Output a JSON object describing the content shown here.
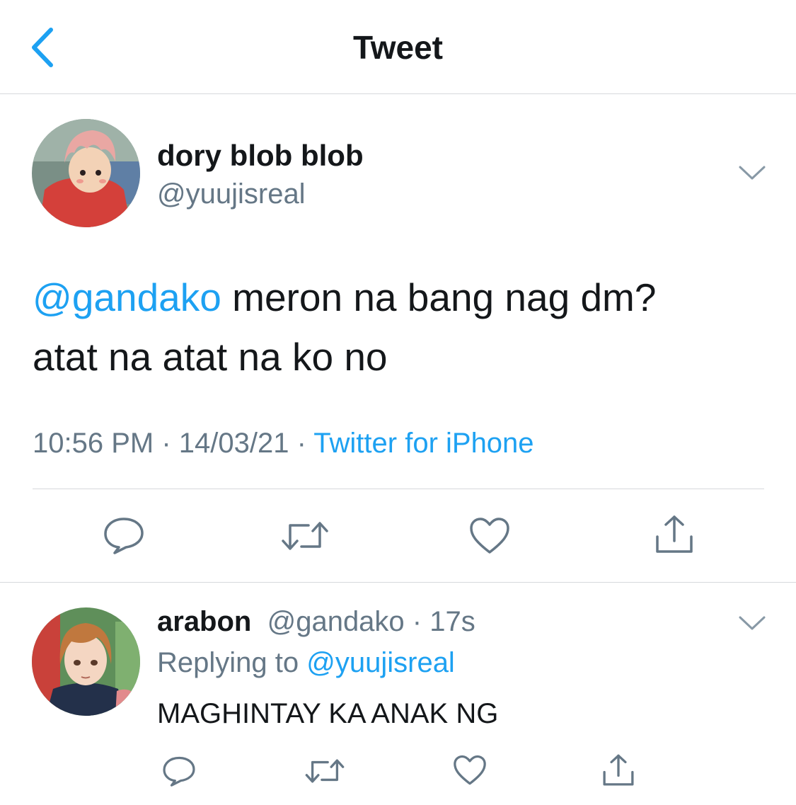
{
  "header": {
    "title": "Tweet"
  },
  "tweet": {
    "display_name": "dory blob blob",
    "handle": "@yuujisreal",
    "mention": "@gandako",
    "text_line1_rest": " meron na bang nag dm?",
    "text_line2": "atat na atat na ko no",
    "time": "10:56 PM",
    "date": "14/03/21",
    "source": "Twitter for iPhone"
  },
  "reply": {
    "display_name": "arabon",
    "handle": "@gandako",
    "age": "17s",
    "replying_label": "Replying to",
    "replying_handle": "@yuujisreal",
    "text": "MAGHINTAY KA ANAK NG"
  },
  "colors": {
    "accent": "#1da1f2",
    "secondary": "#657786",
    "primary": "#14171a",
    "divider": "#d6d9dc"
  },
  "icons": [
    "back-chevron-icon",
    "chevron-down-icon",
    "reply-icon",
    "retweet-icon",
    "like-icon",
    "share-icon"
  ]
}
